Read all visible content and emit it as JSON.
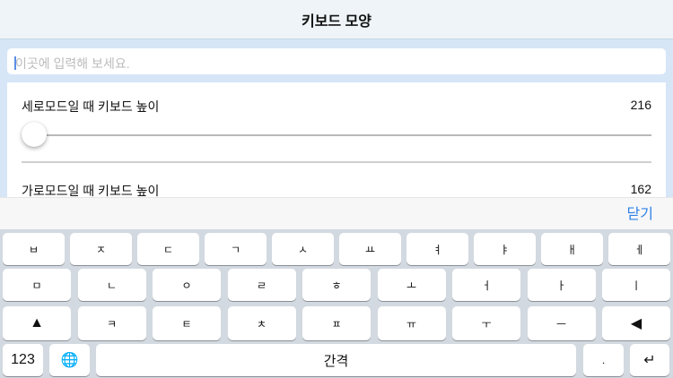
{
  "header": {
    "title": "키보드 모양"
  },
  "input": {
    "placeholder": "이곳에 입력해 보세요."
  },
  "settings": {
    "portrait": {
      "label": "세로모드일 때 키보드 높이",
      "value": "216",
      "slider_fraction": 0.0
    },
    "landscape": {
      "label": "가로모드일 때 키보드 높이",
      "value": "162"
    }
  },
  "toolbar": {
    "close_label": "닫기"
  },
  "keyboard": {
    "row1": [
      "ㅂ",
      "ㅈ",
      "ㄷ",
      "ㄱ",
      "ㅅ",
      "ㅛ",
      "ㅕ",
      "ㅑ",
      "ㅐ",
      "ㅔ"
    ],
    "row2": [
      "ㅁ",
      "ㄴ",
      "ㅇ",
      "ㄹ",
      "ㅎ",
      "ㅗ",
      "ㅓ",
      "ㅏ",
      "ㅣ"
    ],
    "row3": [
      "▲",
      "ㅋ",
      "ㅌ",
      "ㅊ",
      "ㅍ",
      "ㅠ",
      "ㅜ",
      "ㅡ",
      "◀"
    ],
    "row4": {
      "numbers": "123",
      "globe": "🌐",
      "space": "간격",
      "period": ".",
      "return": "↵"
    }
  }
}
